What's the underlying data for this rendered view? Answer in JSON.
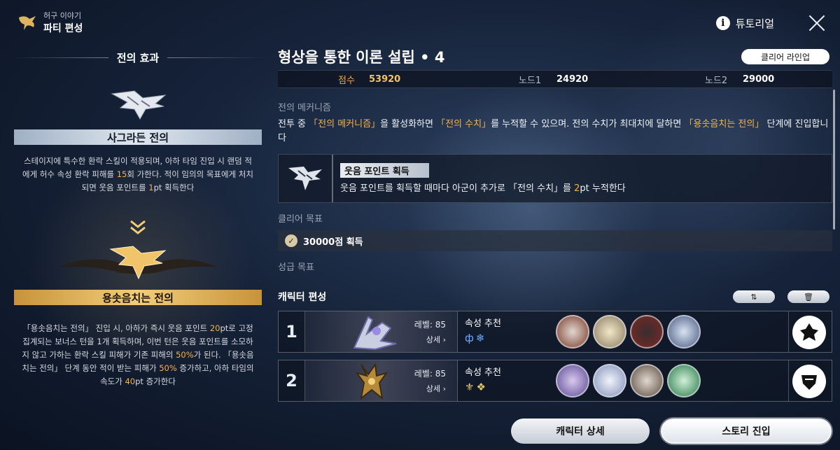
{
  "header": {
    "subtitle": "허구 이야기",
    "title": "파티 편성",
    "tutorial_label": "튜토리얼"
  },
  "left_panel": {
    "section_title": "전의 효과",
    "stage1": {
      "name": "사그라든 전의",
      "desc_parts": [
        "스테이지에 특수한 환락 스킬이 적용되며, 아하 타임 진입 시 랜덤 적에게 허수 속성 환락 피해를 ",
        "15",
        "회 가한다. 적이 임의의 목표에게 처치되면 웃음 포인트를 ",
        "1",
        "pt 획득한다"
      ]
    },
    "stage2": {
      "name": "용솟음치는 전의",
      "desc_parts": [
        "「용솟음치는 전의」 진입 시, 아하가 즉시 웃음 포인트 ",
        "20",
        "pt로 고정 집계되는 보너스 턴을 1개 획득하며, 이번 턴은 웃음 포인트를 소모하지 않고 가하는 환락 스킬 피해가 기존 피해의 ",
        "50%",
        "가 된다. 「용솟음치는 전의」 단계 동안 적이 받는 피해가 ",
        "50%",
        " 증가하고, 아하 타임의 속도가 ",
        "40",
        "pt 증가한다"
      ]
    }
  },
  "main": {
    "title": "형상을 통한 이론 설립 • 4",
    "clear_line_button": "클리어 라인업",
    "score_label": "점수",
    "score_value": "53920",
    "node1_label": "노드1",
    "node1_value": "24920",
    "node2_label": "노드2",
    "node2_value": "29000",
    "mechanism_label": "전의 메커니즘",
    "mechanism_parts": [
      "전투 중 ",
      "「전의 메커니즘」",
      "을 활성화하면 ",
      "「전의 수치」",
      "를 누적할 수 있으며. 전의 수치가 최대치에 달하면 ",
      "「용솟음치는 전의」",
      " 단계에 진입합니다"
    ],
    "card_title": "웃음 포인트 획득",
    "card_desc_parts": [
      "웃음 포인트를 획득할 때마다 아군이 추가로 「전의 수치」를 ",
      "2",
      "pt 누적한다"
    ],
    "clear_goal_label": "클리어 목표",
    "clear_goal": "30000점 획득",
    "star_goal_label": "성급 목표",
    "team_label": "캐릭터 편성",
    "slots": [
      {
        "num": "1",
        "level": "레벨: 85",
        "detail": "상세",
        "elem_title": "속성 추천",
        "elem_icons": "ф❄"
      },
      {
        "num": "2",
        "level": "레벨: 85",
        "detail": "상세",
        "elem_title": "속성 추천",
        "elem_icons": "⚜❖"
      }
    ],
    "char_detail_button": "캐릭터 상세",
    "story_button": "스토리 진입"
  },
  "colors": {
    "orange": "#f3b24a",
    "gold": "#f1cd7a"
  }
}
